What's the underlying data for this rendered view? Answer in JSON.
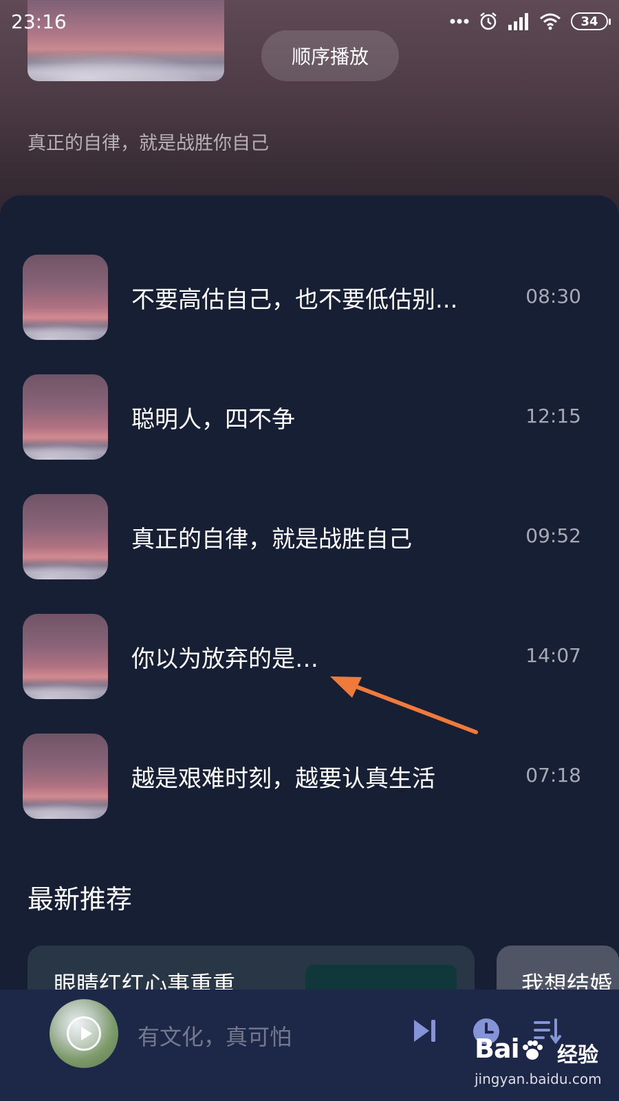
{
  "status_bar": {
    "time": "23:16",
    "battery": "34",
    "icons": [
      "more-dots-icon",
      "alarm-icon",
      "signal-icon",
      "wifi-icon",
      "battery-icon"
    ]
  },
  "hero": {
    "order_button": "顺序播放",
    "description": "真正的自律，就是战胜你自己"
  },
  "tracks": [
    {
      "title": "不要高估自己，也不要低估别...",
      "duration": "08:30"
    },
    {
      "title": "聪明人，四不争",
      "duration": "12:15"
    },
    {
      "title": "真正的自律，就是战胜自己",
      "duration": "09:52"
    },
    {
      "title": "你以为放弃的是…",
      "duration": "14:07"
    },
    {
      "title": "越是艰难时刻，越要认真生活",
      "duration": "07:18"
    }
  ],
  "recommend": {
    "section_title": "最新推荐",
    "cards": [
      {
        "title": "眼睛红红心事重重"
      },
      {
        "title": "我想结婚"
      }
    ]
  },
  "player": {
    "title": "有文化，真可怕",
    "controls": [
      "next-icon",
      "timer-icon",
      "playlist-icon"
    ]
  },
  "watermark": {
    "brand_left": "Bai",
    "brand_right": "经验",
    "domain": "jingyan.baidu.com"
  },
  "colors": {
    "panel_bg": "#171f35",
    "player_bg": "#1d2747",
    "arrow": "#f07a3a",
    "control_icon": "#8594d6"
  }
}
